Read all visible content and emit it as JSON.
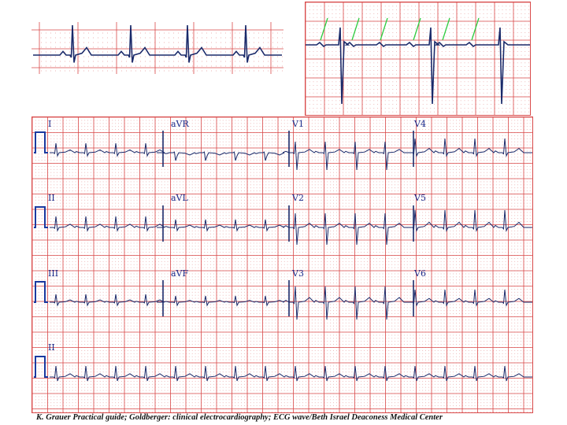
{
  "main_leads": [
    {
      "id": "I",
      "label": "I"
    },
    {
      "id": "aVR",
      "label": "aVR"
    },
    {
      "id": "V1",
      "label": "V1"
    },
    {
      "id": "V4",
      "label": "V4"
    },
    {
      "id": "II",
      "label": "II"
    },
    {
      "id": "aVL",
      "label": "aVL"
    },
    {
      "id": "V2",
      "label": "V2"
    },
    {
      "id": "V5",
      "label": "V5"
    },
    {
      "id": "III",
      "label": "III"
    },
    {
      "id": "aVF",
      "label": "aVF"
    },
    {
      "id": "V3",
      "label": "V3"
    },
    {
      "id": "V6",
      "label": "V6"
    },
    {
      "id": "II-rhythm",
      "label": "II"
    }
  ],
  "colors": {
    "grid_major": "#d94a4a",
    "grid_minor": "#e8a0a0",
    "trace": "#1a2a6a",
    "annotation": "#2ecc40",
    "calibration": "#1a3aa0"
  },
  "caption": "K. Grauer Practical guide; Goldberger: clinical electrocardiography; ECG wave/Beth Israel Deaconess Medical Center"
}
